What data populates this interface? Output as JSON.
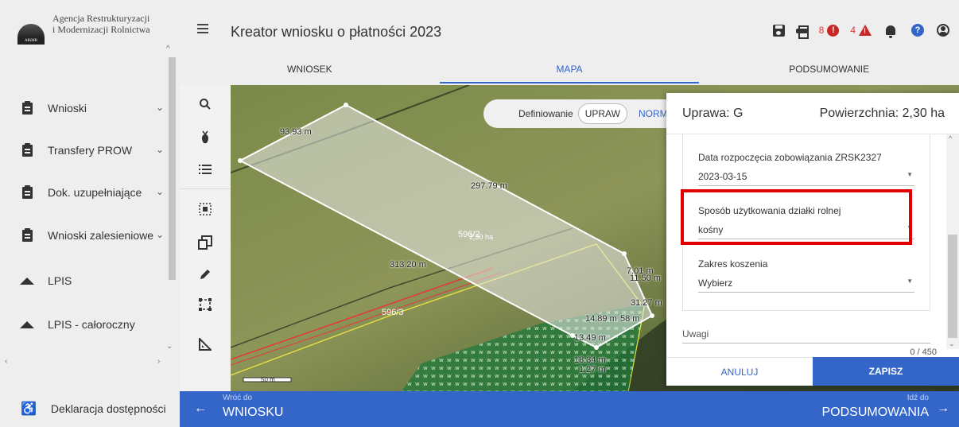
{
  "sidebar": {
    "logo_line1": "Agencja Restrukturyzacji",
    "logo_line2": "i Modernizacji Rolnictwa",
    "logo_mark": "ARiMR",
    "items": [
      {
        "label": "Wnioski",
        "icon": "clipboard-icon"
      },
      {
        "label": "Transfery PROW",
        "icon": "clipboard-icon"
      },
      {
        "label": "Dok. uzupełniające",
        "icon": "clipboard-icon"
      },
      {
        "label": "Wnioski zalesieniowe",
        "icon": "clipboard-icon"
      },
      {
        "label": "LPIS",
        "icon": "mountain-icon"
      },
      {
        "label": "LPIS - całoroczny",
        "icon": "mountain-icon"
      }
    ],
    "accessibility_label": "Deklaracja dostępności"
  },
  "header": {
    "title": "Kreator wniosku o płatności 2023",
    "error_count": "8",
    "warning_count": "4"
  },
  "tabs": [
    {
      "label": "WNIOSEK",
      "active": false
    },
    {
      "label": "MAPA",
      "active": true
    },
    {
      "label": "PODSUMOWANIE",
      "active": false
    }
  ],
  "map": {
    "define_label": "Definiowanie",
    "define_selected": "UPRAW",
    "define_other": "NORM",
    "labels": {
      "l1": "93.93 m",
      "l2": "297.79 m",
      "l3": "596/2",
      "l3b": "2,30 ha",
      "l4": "313.20 m",
      "l5": "596/3",
      "l6": "7.01 m",
      "l7": "11.50 m",
      "l8": "31.27 m",
      "l9": "14.89 m",
      "l10": "58 m",
      "l11": "13.49 m",
      "l12": "18.34 m",
      "l13": "1.27 m",
      "scale": "50 m"
    }
  },
  "panel": {
    "crop_label": "Uprawa: G",
    "area_label": "Powierzchnia: 2,30 ha",
    "fields": [
      {
        "label": "Data rozpoczęcia zobowiązania ZRSK2327",
        "value": "2023-03-15"
      },
      {
        "label": "Sposób użytkowania działki rolnej",
        "value": "kośny"
      },
      {
        "label": "Zakres koszenia",
        "value": "Wybierz"
      }
    ],
    "notes_label": "Uwagi",
    "notes_counter": "0 / 450",
    "cancel_label": "ANULUJ",
    "save_label": "ZAPISZ"
  },
  "footer": {
    "prev_small": "Wróć do",
    "prev_label": "WNIOSKU",
    "next_small": "Idź do",
    "next_label": "PODSUMOWANIA"
  },
  "colors": {
    "accent": "#3465c8",
    "error": "#c62828",
    "highlight": "#e00000"
  }
}
